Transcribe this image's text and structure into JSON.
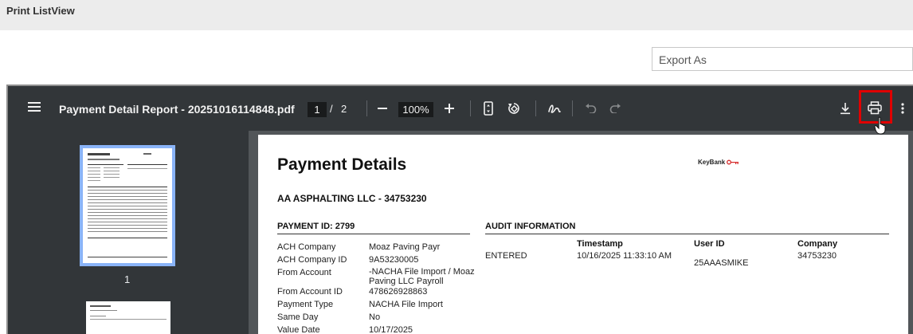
{
  "page": {
    "title": "Print ListView"
  },
  "export": {
    "placeholder": "Export As"
  },
  "viewer": {
    "filename": "Payment Detail Report - 20251016114848.pdf",
    "current_page": "1",
    "page_sep": "/",
    "total_pages": "2",
    "zoom": "100%",
    "thumb_page_label": "1"
  },
  "report": {
    "title": "Payment Details",
    "logo_text": "KeyBank",
    "company": "AA ASPHALTING LLC - 34753230",
    "payment_header": "PAYMENT ID: 2799",
    "audit_header": "AUDIT INFORMATION",
    "fields": [
      {
        "label": "ACH Company",
        "value": "Moaz Paving Payr"
      },
      {
        "label": "ACH Company ID",
        "value": "9A53230005"
      },
      {
        "label": "From Account",
        "value": "-NACHA File Import / Moaz Paving LLC Payroll"
      },
      {
        "label": "From Account ID",
        "value": "478626928863"
      },
      {
        "label": "Payment Type",
        "value": "NACHA File Import"
      },
      {
        "label": "Same Day",
        "value": "No"
      },
      {
        "label": "Value Date",
        "value": "10/17/2025"
      }
    ],
    "audit": {
      "headers": {
        "timestamp": "Timestamp",
        "user_id": "User ID",
        "company": "Company"
      },
      "row": {
        "action": "ENTERED",
        "timestamp": "10/16/2025 11:33:10 AM",
        "user_id": "25AAASMIKE",
        "company": "34753230"
      }
    }
  },
  "colors": {
    "toolbar": "#323639",
    "viewer_bg": "#525659",
    "thumb_border": "#8ab4f8",
    "highlight": "#e00000"
  }
}
